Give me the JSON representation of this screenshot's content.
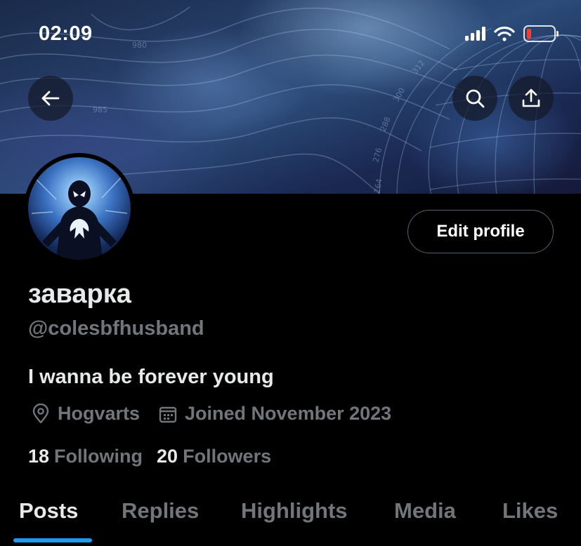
{
  "status_bar": {
    "time": "02:09",
    "icons": [
      "cellular-signal-icon",
      "wifi-icon",
      "battery-icon"
    ],
    "battery_color": "#ff3b30"
  },
  "banner": {
    "buttons": [
      "back-arrow-icon",
      "search-icon",
      "share-icon"
    ]
  },
  "profile": {
    "display_name": "заварка",
    "handle": "@colesbfhusband",
    "bio": "I wanna be forever young",
    "location": "Hogvarts",
    "joined": "Joined November 2023",
    "following_count": "18",
    "following_label": "Following",
    "followers_count": "20",
    "followers_label": "Followers",
    "edit_button_label": "Edit profile"
  },
  "tabs": [
    {
      "label": "Posts",
      "active": true
    },
    {
      "label": "Replies",
      "active": false
    },
    {
      "label": "Highlights",
      "active": false
    },
    {
      "label": "Media",
      "active": false
    },
    {
      "label": "Likes",
      "active": false
    }
  ],
  "colors": {
    "accent": "#1d9bf0",
    "secondary_text": "#71767b",
    "primary_text": "#e7e9ea",
    "background": "#000000"
  }
}
